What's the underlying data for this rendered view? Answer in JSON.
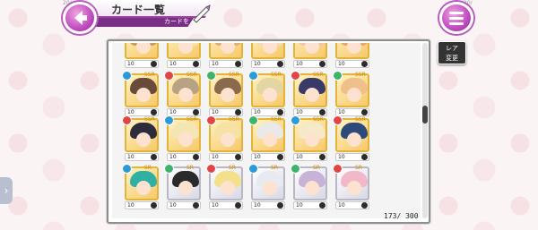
{
  "header": {
    "title": "カード一覧",
    "subtitle": "カードを",
    "version_left": "20/",
    "version_right": "20/"
  },
  "rare_button": {
    "line1": "レア",
    "line2": "変更"
  },
  "side_tab": {
    "glyph": "›"
  },
  "count": {
    "current": "173",
    "separator": "/",
    "max": "300"
  },
  "colors": {
    "accent": "#b65bbd",
    "gold_frame": "#e2b43a",
    "silver_frame": "#b8b8c4"
  },
  "cards": [
    {
      "row": 0,
      "col": 0,
      "tier": "gold",
      "gem": "#e24545",
      "hair": "#c79a6a",
      "stars": "SSR",
      "lv": "10"
    },
    {
      "row": 0,
      "col": 1,
      "tier": "gold",
      "gem": "#2a9ad9",
      "hair": "#f4e2a6",
      "stars": "SSR",
      "lv": "10"
    },
    {
      "row": 0,
      "col": 2,
      "tier": "gold",
      "gem": "#e24545",
      "hair": "#d7b27d",
      "stars": "SSR",
      "lv": "10"
    },
    {
      "row": 0,
      "col": 3,
      "tier": "gold",
      "gem": "#3fb36b",
      "hair": "#f6d9c1",
      "stars": "SSR",
      "lv": "10"
    },
    {
      "row": 0,
      "col": 4,
      "tier": "gold",
      "gem": "#e24545",
      "hair": "#f1c4b3",
      "stars": "SSR",
      "lv": "10"
    },
    {
      "row": 0,
      "col": 5,
      "tier": "gold",
      "gem": "#2a9ad9",
      "hair": "#e8a56f",
      "stars": "SSR",
      "lv": "10"
    },
    {
      "row": 1,
      "col": 0,
      "tier": "gold",
      "gem": "#2a9ad9",
      "hair": "#6a4a3a",
      "stars": "SSR",
      "lv": "10"
    },
    {
      "row": 1,
      "col": 1,
      "tier": "gold",
      "gem": "#e24545",
      "hair": "#b8a283",
      "stars": "SSR",
      "lv": "10"
    },
    {
      "row": 1,
      "col": 2,
      "tier": "gold",
      "gem": "#3fb36b",
      "hair": "#8a6a4c",
      "stars": "SSR",
      "lv": "10"
    },
    {
      "row": 1,
      "col": 3,
      "tier": "gold",
      "gem": "#2a9ad9",
      "hair": "#e4d6a2",
      "stars": "SSR",
      "lv": "10"
    },
    {
      "row": 1,
      "col": 4,
      "tier": "gold",
      "gem": "#e24545",
      "hair": "#3a3a6a",
      "stars": "SSR",
      "lv": "10"
    },
    {
      "row": 1,
      "col": 5,
      "tier": "gold",
      "gem": "#3fb36b",
      "hair": "#f0c08a",
      "stars": "SSR",
      "lv": "10"
    },
    {
      "row": 2,
      "col": 0,
      "tier": "gold",
      "gem": "#e24545",
      "hair": "#2c2c3a",
      "stars": "SSR",
      "lv": "10"
    },
    {
      "row": 2,
      "col": 1,
      "tier": "gold",
      "gem": "#2a9ad9",
      "hair": "#f3e6b4",
      "stars": "SSR",
      "lv": "10"
    },
    {
      "row": 2,
      "col": 2,
      "tier": "gold",
      "gem": "#e24545",
      "hair": "#f5e2a4",
      "stars": "SSR",
      "lv": "10"
    },
    {
      "row": 2,
      "col": 3,
      "tier": "gold",
      "gem": "#3fb36b",
      "hair": "#e9e9e9",
      "stars": "SSR",
      "lv": "10"
    },
    {
      "row": 2,
      "col": 4,
      "tier": "gold",
      "gem": "#2a9ad9",
      "hair": "#f6e9c9",
      "stars": "SSR",
      "lv": "10"
    },
    {
      "row": 2,
      "col": 5,
      "tier": "gold",
      "gem": "#e24545",
      "hair": "#2e4a7a",
      "stars": "SSR",
      "lv": "10"
    },
    {
      "row": 3,
      "col": 0,
      "tier": "gold",
      "gem": "#2a9ad9",
      "hair": "#2fb0a3",
      "stars": "SR",
      "lv": "10"
    },
    {
      "row": 3,
      "col": 1,
      "tier": "silver",
      "gem": "#3fb36b",
      "hair": "#2a2a2a",
      "stars": "SR",
      "lv": "10"
    },
    {
      "row": 3,
      "col": 2,
      "tier": "silver",
      "gem": "#e24545",
      "hair": "#f3e08a",
      "stars": "SR",
      "lv": "10"
    },
    {
      "row": 3,
      "col": 3,
      "tier": "silver",
      "gem": "#2a9ad9",
      "hair": "#e8eaf2",
      "stars": "SR",
      "lv": "10"
    },
    {
      "row": 3,
      "col": 4,
      "tier": "silver",
      "gem": "#3fb36b",
      "hair": "#c9b2d8",
      "stars": "SR",
      "lv": "10"
    },
    {
      "row": 3,
      "col": 5,
      "tier": "silver",
      "gem": "#e24545",
      "hair": "#f0b8c8",
      "stars": "SR",
      "lv": "10"
    }
  ]
}
